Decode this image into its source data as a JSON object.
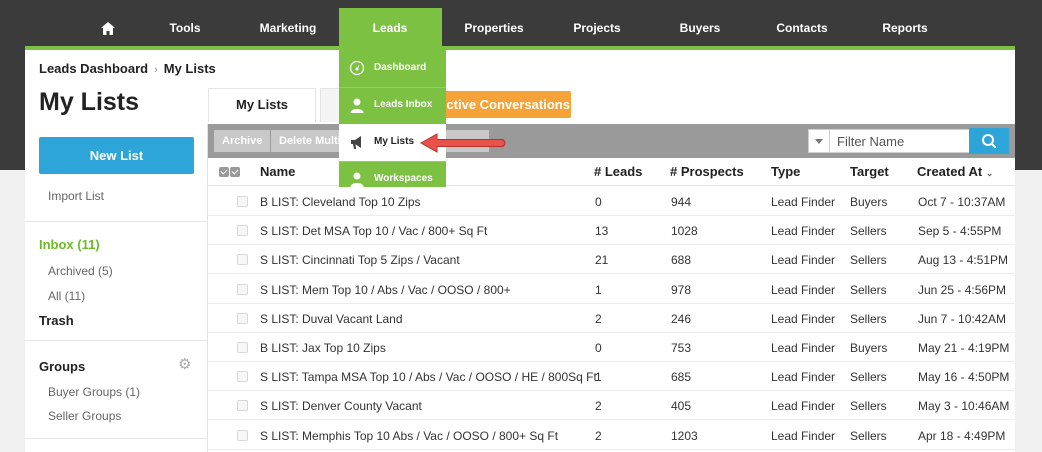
{
  "nav": {
    "items": [
      "Tools",
      "Marketing",
      "Leads",
      "Properties",
      "Projects",
      "Buyers",
      "Contacts",
      "Reports"
    ],
    "leads_menu": [
      "Dashboard",
      "Leads Inbox",
      "My Lists",
      "Workspaces"
    ]
  },
  "breadcrumb": {
    "parent": "Leads Dashboard",
    "current": "My Lists"
  },
  "page": {
    "title": "My Lists"
  },
  "tabs": {
    "active": "My Lists",
    "orange": "Active Conversations"
  },
  "sidebar": {
    "new_list": "New List",
    "import": "Import List",
    "inbox": "Inbox (11)",
    "archived": "Archived (5)",
    "all": "All (11)",
    "trash": "Trash",
    "groups": "Groups",
    "buyer_groups": "Buyer Groups (1)",
    "seller_groups": "Seller Groups"
  },
  "toolbar": {
    "archive": "Archive",
    "delete": "Delete Multiple",
    "filter_placeholder": "Filter Name"
  },
  "table": {
    "headers": [
      "Name",
      "# Leads",
      "# Prospects",
      "Type",
      "Target",
      "Created At"
    ],
    "rows": [
      [
        "B LIST: Cleveland Top 10 Zips",
        "0",
        "944",
        "Lead Finder",
        "Buyers",
        "Oct 7 - 10:37AM"
      ],
      [
        "S LIST: Det MSA Top 10 / Vac / 800+ Sq Ft",
        "13",
        "1028",
        "Lead Finder",
        "Sellers",
        "Sep 5 - 4:55PM"
      ],
      [
        "S LIST: Cincinnati Top 5 Zips / Vacant",
        "21",
        "688",
        "Lead Finder",
        "Sellers",
        "Aug 13 - 4:51PM"
      ],
      [
        "S LIST: Mem Top 10 / Abs / Vac / OOSO / 800+",
        "1",
        "978",
        "Lead Finder",
        "Sellers",
        "Jun 25 - 4:56PM"
      ],
      [
        "S LIST: Duval Vacant Land",
        "2",
        "246",
        "Lead Finder",
        "Sellers",
        "Jun 7 - 10:42AM"
      ],
      [
        "B LIST: Jax Top 10 Zips",
        "0",
        "753",
        "Lead Finder",
        "Buyers",
        "May 21 - 4:19PM"
      ],
      [
        "S LIST: Tampa MSA Top 10 / Abs / Vac / OOSO / HE / 800Sq Ft",
        "1",
        "685",
        "Lead Finder",
        "Sellers",
        "May 16 - 4:50PM"
      ],
      [
        "S LIST: Denver County Vacant",
        "2",
        "405",
        "Lead Finder",
        "Sellers",
        "May 3 - 10:46AM"
      ],
      [
        "S LIST: Memphis Top 10 Abs / Vac / OOSO / 800+ Sq Ft",
        "2",
        "1203",
        "Lead Finder",
        "Sellers",
        "Apr 18 - 4:49PM"
      ]
    ]
  },
  "colors": {
    "green": "#7dc142",
    "blue": "#2ea5d9",
    "orange": "#f5a238",
    "arrow": "#e8524a"
  }
}
